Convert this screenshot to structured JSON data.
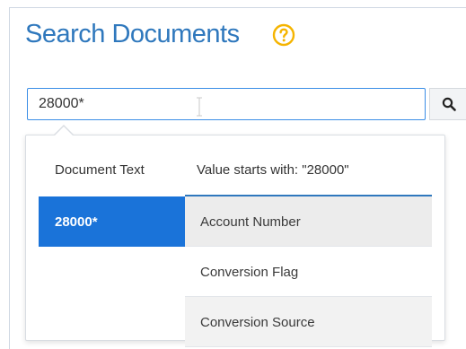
{
  "header": {
    "title": "Search Documents",
    "help_icon": "question-circle-icon"
  },
  "search": {
    "value": "28000*",
    "search_icon": "search-icon"
  },
  "suggestions": {
    "column_label": "Document Text",
    "hint": "Value starts with: \"28000\"",
    "term": "28000*",
    "fields": [
      {
        "label": "Account Number"
      },
      {
        "label": "Conversion Flag"
      },
      {
        "label": "Conversion Source"
      }
    ]
  },
  "colors": {
    "accent": "#2f78bd",
    "selected": "#1a73d9",
    "help": "#f5b400"
  }
}
